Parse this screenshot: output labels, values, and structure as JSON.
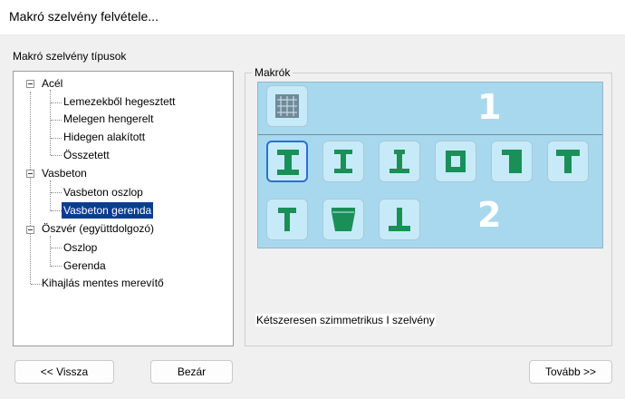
{
  "window": {
    "title": "Makró szelvény felvétele..."
  },
  "types_panel": {
    "label": "Makró szelvény típusok",
    "tree": [
      {
        "label": "Acél",
        "level": 0
      },
      {
        "label": "Lemezekből hegesztett",
        "level": 1
      },
      {
        "label": "Melegen hengerelt",
        "level": 1
      },
      {
        "label": "Hidegen alakított",
        "level": 1
      },
      {
        "label": "Összetett",
        "level": 1
      },
      {
        "label": "Vasbeton",
        "level": 0
      },
      {
        "label": "Vasbeton oszlop",
        "level": 1
      },
      {
        "label": "Vasbeton gerenda",
        "level": 1,
        "selected": true
      },
      {
        "label": "Öszvér (együttdolgozó)",
        "level": 0
      },
      {
        "label": "Oszlop",
        "level": 1
      },
      {
        "label": "Gerenda",
        "level": 1
      },
      {
        "label": "Kihajlás mentes merevítő",
        "level": 0
      }
    ]
  },
  "macros_panel": {
    "label": "Makrók",
    "section_numbers": [
      "1",
      "2"
    ],
    "icons_row1": [
      "grid-section-icon"
    ],
    "icons_row2": [
      "symmetric-i-section-icon",
      "i-section-icon",
      "asymmetric-i-section-icon",
      "hollow-box-section-icon",
      "l-shaped-section-icon",
      "t-section-icon",
      "column-t-section-icon",
      "trapezoid-section-icon",
      "inverted-t-section-icon"
    ],
    "description": "Kétszeresen szimmetrikus I szelvény"
  },
  "buttons": {
    "back": "<< Vissza",
    "close": "Bezár",
    "next": "Tovább >>"
  },
  "colors": {
    "section_fill": "#1a8f58",
    "macro_background": "#a8d8ee",
    "tile_background": "#c7eaf8",
    "selection": "#0a3d91"
  }
}
